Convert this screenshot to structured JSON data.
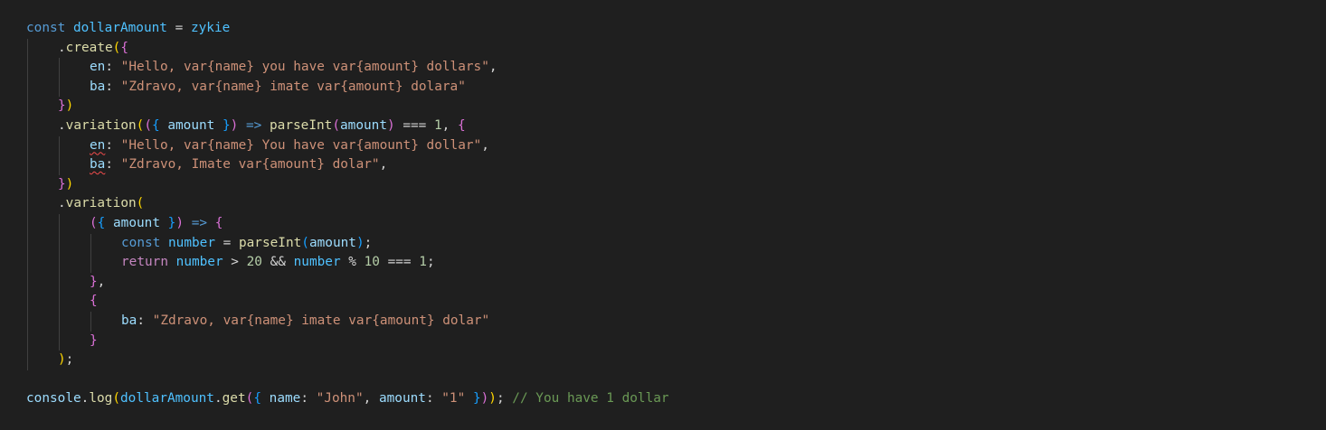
{
  "colors": {
    "background": "#1f1f1f",
    "keyword": "#569cd6",
    "variable": "#9cdcfe",
    "constant": "#4fc1ff",
    "function": "#dcdcaa",
    "string": "#ce9178",
    "number": "#b5cea8",
    "comment": "#6a9955",
    "control": "#c586c0",
    "bracket1": "#ffd700",
    "bracket2": "#da70d6",
    "bracket3": "#179fff",
    "plain": "#d4d4d4",
    "error_squiggle": "#f14c4c"
  },
  "code_lines": [
    {
      "indent": 0,
      "tokens": [
        [
          "const",
          "keyword"
        ],
        [
          " ",
          "plain"
        ],
        [
          "dollarAmount",
          "constant"
        ],
        [
          " = ",
          "plain"
        ],
        [
          "zykie",
          "constant"
        ]
      ]
    },
    {
      "indent": 1,
      "tokens": [
        [
          ".",
          "plain"
        ],
        [
          "create",
          "function"
        ],
        [
          "(",
          "bracket1"
        ],
        [
          "{",
          "bracket2"
        ]
      ]
    },
    {
      "indent": 2,
      "tokens": [
        [
          "en",
          "variable"
        ],
        [
          ": ",
          "plain"
        ],
        [
          "\"Hello, var{name} you have var{amount} dollars\"",
          "string"
        ],
        [
          ",",
          "plain"
        ]
      ]
    },
    {
      "indent": 2,
      "tokens": [
        [
          "ba",
          "variable"
        ],
        [
          ": ",
          "plain"
        ],
        [
          "\"Zdravo, var{name} imate var{amount} dolara\"",
          "string"
        ]
      ]
    },
    {
      "indent": 1,
      "tokens": [
        [
          "}",
          "bracket2"
        ],
        [
          ")",
          "bracket1"
        ]
      ]
    },
    {
      "indent": 1,
      "tokens": [
        [
          ".",
          "plain"
        ],
        [
          "variation",
          "function"
        ],
        [
          "(",
          "bracket1"
        ],
        [
          "(",
          "bracket2"
        ],
        [
          "{",
          "bracket3"
        ],
        [
          " ",
          "plain"
        ],
        [
          "amount",
          "variable"
        ],
        [
          " ",
          "plain"
        ],
        [
          "}",
          "bracket3"
        ],
        [
          ")",
          "bracket2"
        ],
        [
          " ",
          "plain"
        ],
        [
          "=>",
          "keyword"
        ],
        [
          " ",
          "plain"
        ],
        [
          "parseInt",
          "function"
        ],
        [
          "(",
          "bracket2"
        ],
        [
          "amount",
          "variable"
        ],
        [
          ")",
          "bracket2"
        ],
        [
          " === ",
          "plain"
        ],
        [
          "1",
          "number"
        ],
        [
          ", ",
          "plain"
        ],
        [
          "{",
          "bracket2"
        ]
      ]
    },
    {
      "indent": 2,
      "tokens": [
        [
          "en",
          "variable",
          1
        ],
        [
          ": ",
          "plain"
        ],
        [
          "\"Hello, var{name} You have var{amount} dollar\"",
          "string"
        ],
        [
          ",",
          "plain"
        ]
      ]
    },
    {
      "indent": 2,
      "tokens": [
        [
          "ba",
          "variable",
          1
        ],
        [
          ": ",
          "plain"
        ],
        [
          "\"Zdravo, Imate var{amount} dolar\"",
          "string"
        ],
        [
          ",",
          "plain"
        ]
      ]
    },
    {
      "indent": 1,
      "tokens": [
        [
          "}",
          "bracket2"
        ],
        [
          ")",
          "bracket1"
        ]
      ]
    },
    {
      "indent": 1,
      "tokens": [
        [
          ".",
          "plain"
        ],
        [
          "variation",
          "function"
        ],
        [
          "(",
          "bracket1"
        ]
      ]
    },
    {
      "indent": 2,
      "tokens": [
        [
          "(",
          "bracket2"
        ],
        [
          "{",
          "bracket3"
        ],
        [
          " ",
          "plain"
        ],
        [
          "amount",
          "variable"
        ],
        [
          " ",
          "plain"
        ],
        [
          "}",
          "bracket3"
        ],
        [
          ")",
          "bracket2"
        ],
        [
          " ",
          "plain"
        ],
        [
          "=>",
          "keyword"
        ],
        [
          " ",
          "plain"
        ],
        [
          "{",
          "bracket2"
        ]
      ]
    },
    {
      "indent": 3,
      "tokens": [
        [
          "const",
          "keyword"
        ],
        [
          " ",
          "plain"
        ],
        [
          "number",
          "constant"
        ],
        [
          " = ",
          "plain"
        ],
        [
          "parseInt",
          "function"
        ],
        [
          "(",
          "bracket3"
        ],
        [
          "amount",
          "variable"
        ],
        [
          ")",
          "bracket3"
        ],
        [
          ";",
          "plain"
        ]
      ]
    },
    {
      "indent": 3,
      "tokens": [
        [
          "return",
          "control"
        ],
        [
          " ",
          "plain"
        ],
        [
          "number",
          "constant"
        ],
        [
          " > ",
          "plain"
        ],
        [
          "20",
          "number"
        ],
        [
          " && ",
          "plain"
        ],
        [
          "number",
          "constant"
        ],
        [
          " % ",
          "plain"
        ],
        [
          "10",
          "number"
        ],
        [
          " === ",
          "plain"
        ],
        [
          "1",
          "number"
        ],
        [
          ";",
          "plain"
        ]
      ]
    },
    {
      "indent": 2,
      "tokens": [
        [
          "}",
          "bracket2"
        ],
        [
          ",",
          "plain"
        ]
      ]
    },
    {
      "indent": 2,
      "tokens": [
        [
          "{",
          "bracket2"
        ]
      ]
    },
    {
      "indent": 3,
      "tokens": [
        [
          "ba",
          "variable"
        ],
        [
          ": ",
          "plain"
        ],
        [
          "\"Zdravo, var{name} imate var{amount} dolar\"",
          "string"
        ]
      ]
    },
    {
      "indent": 2,
      "tokens": [
        [
          "}",
          "bracket2"
        ]
      ]
    },
    {
      "indent": 1,
      "tokens": [
        [
          ")",
          "bracket1"
        ],
        [
          ";",
          "plain"
        ]
      ]
    },
    {
      "indent": 0,
      "tokens": []
    },
    {
      "indent": 0,
      "tokens": [
        [
          "console",
          "variable"
        ],
        [
          ".",
          "plain"
        ],
        [
          "log",
          "function"
        ],
        [
          "(",
          "bracket1"
        ],
        [
          "dollarAmount",
          "constant"
        ],
        [
          ".",
          "plain"
        ],
        [
          "get",
          "function"
        ],
        [
          "(",
          "bracket2"
        ],
        [
          "{",
          "bracket3"
        ],
        [
          " ",
          "plain"
        ],
        [
          "name",
          "variable"
        ],
        [
          ": ",
          "plain"
        ],
        [
          "\"John\"",
          "string"
        ],
        [
          ", ",
          "plain"
        ],
        [
          "amount",
          "variable"
        ],
        [
          ": ",
          "plain"
        ],
        [
          "\"1\"",
          "string"
        ],
        [
          " ",
          "plain"
        ],
        [
          "}",
          "bracket3"
        ],
        [
          ")",
          "bracket2"
        ],
        [
          ")",
          "bracket1"
        ],
        [
          ";",
          "plain"
        ],
        [
          " ",
          "plain"
        ],
        [
          "// You have 1 dollar",
          "comment"
        ]
      ]
    }
  ]
}
